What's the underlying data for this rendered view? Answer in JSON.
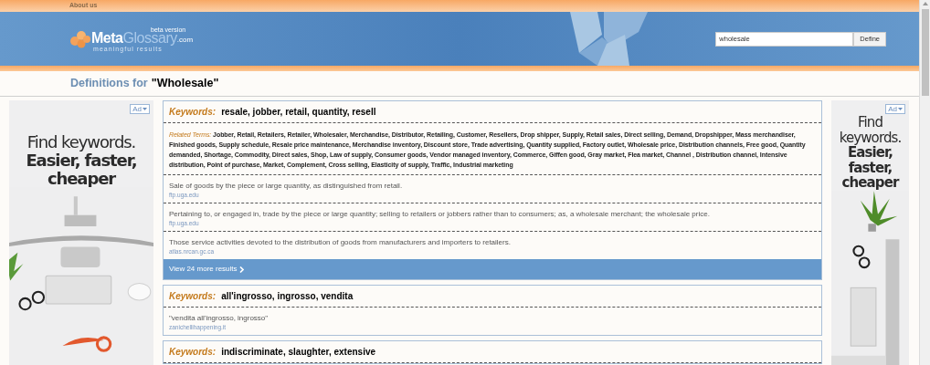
{
  "top_bar": {
    "link": "About us"
  },
  "logo": {
    "part_1": "Meta",
    "part_2": "Glossary",
    "domain": ".com",
    "badge": "beta version",
    "tagline": "meaningful results"
  },
  "search": {
    "value": "wholesale",
    "button": "Define"
  },
  "heading": {
    "prefix": "Definitions for",
    "term": "\"Wholesale\""
  },
  "ads": [
    {
      "label": "Ad",
      "lines": [
        "Find keywords.",
        "Easier, faster,",
        "cheaper"
      ]
    },
    {
      "label": "Ad",
      "lines": [
        "Find",
        "keywords.",
        "Easier,",
        "faster,",
        "cheaper"
      ]
    }
  ],
  "results": [
    {
      "label": "Keywords:",
      "keywords": "resale, jobber, retail, quantity, resell",
      "related_label": "Related Terms:",
      "related": "Jobber, Retail, Retailers, Retailer, Wholesaler, Merchandise, Distributor, Retailing, Customer, Resellers, Drop shipper, Supply, Retail sales, Direct selling, Demand, Dropshipper, Mass merchandiser, Finished goods, Supply schedule, Resale price maintenance, Merchandise inventory, Discount store, Trade advertising, Quantity supplied, Factory outlet, Wholesale price, Distribution channels, Free good, Quantity demanded, Shortage, Commodity, Direct sales, Shop, Law of supply, Consumer goods, Vendor managed inventory, Commerce, Giffen good, Gray market, Flea market, Channel , Distribution channel, Intensive distribution, Point of purchase, Market, Complement, Cross selling, Elasticity of supply, Traffic, Industrial marketing",
      "definitions": [
        {
          "text": "Sale of goods by the piece or large quantity, as distinguished from retail.",
          "source": "ftp.uga.edu"
        },
        {
          "text": "Pertaining to, or engaged in, trade by the piece or large quantity; selling to retailers or jobbers rather than to consumers; as, a wholesale merchant; the wholesale price.",
          "source": "ftp.uga.edu"
        },
        {
          "text": "Those service activities devoted to the distribution of goods from manufacturers and importers to retailers.",
          "source": "atlas.nrcan.gc.ca"
        }
      ],
      "more": "View 24 more results"
    },
    {
      "label": "Keywords:",
      "keywords": "all'ingrosso, ingrosso, vendita",
      "definitions": [
        {
          "text": "\"vendita all'ingrosso, ingrosso\"",
          "source": "zanichellihappening.it"
        }
      ]
    },
    {
      "label": "Keywords:",
      "keywords": "indiscriminate, slaughter, extensive"
    }
  ]
}
